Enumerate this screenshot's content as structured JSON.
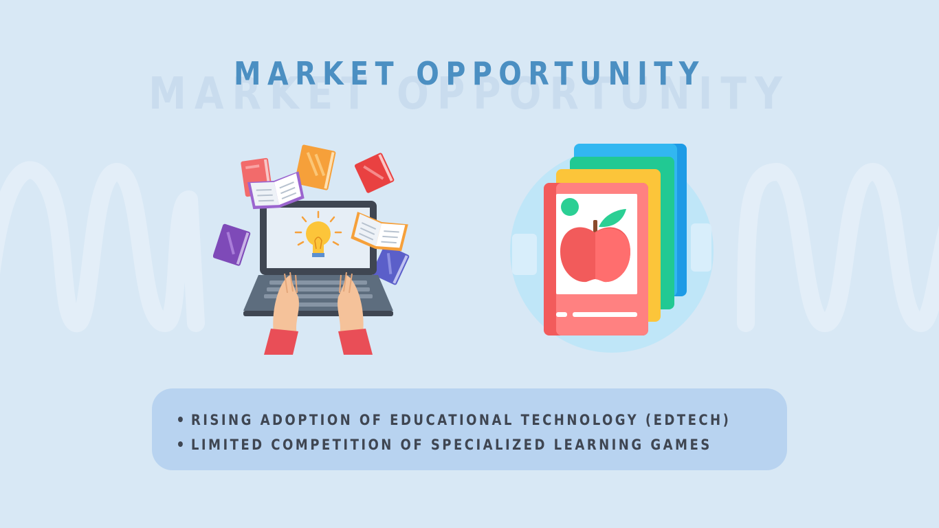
{
  "slide": {
    "title": "MARKET OPPORTUNITY",
    "title_shadow": "MARKET OPPORTUNITY"
  },
  "illustrations": [
    {
      "icon": "laptop-with-books-lightbulb-icon"
    },
    {
      "icon": "apple-flashcards-icon"
    }
  ],
  "bullets": [
    "RISING ADOPTION OF EDUCATIONAL TECHNOLOGY (EDTECH)",
    "LIMITED COMPETITION OF SPECIALIZED LEARNING GAMES"
  ],
  "colors": {
    "background": "#d8e8f5",
    "title": "#4b8fc2",
    "title_shadow": "#c9dcee",
    "panel": "#b8d3f0",
    "bullet_text": "#3f4652"
  }
}
